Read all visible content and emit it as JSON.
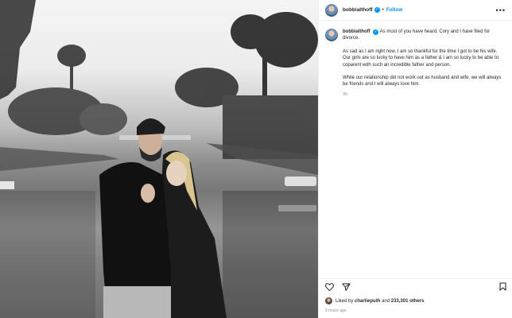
{
  "post": {
    "username": "bobbialthoff",
    "follow_label": "Follow",
    "separator": "•",
    "more_label": "•••",
    "caption": {
      "p1": "As most of you have heard, Cory and I have filed for divorce.",
      "p2": "As sad as I am right now, I am so thankful for the time I got to be his wife. Our girls are so lucky to have him as a father & I am so lucky to be able to coparent with such an incredible father and person.",
      "p3": "While our relationship did not work out as husband and wife, we will always be friends and I will always love him."
    },
    "caption_time": "3h",
    "likes": {
      "prefix": "Liked by",
      "by_user": "charlieputh",
      "and": "and",
      "count_text": "233,301 others"
    },
    "posted_ago": "5 hours ago"
  },
  "icons": {
    "verified": "verified-badge-icon",
    "like": "heart-icon",
    "share": "paper-plane-icon",
    "save": "bookmark-icon"
  },
  "colors": {
    "accent": "#0095f6",
    "text": "#262626",
    "muted": "#8e8e8e",
    "divider": "#efefef"
  }
}
